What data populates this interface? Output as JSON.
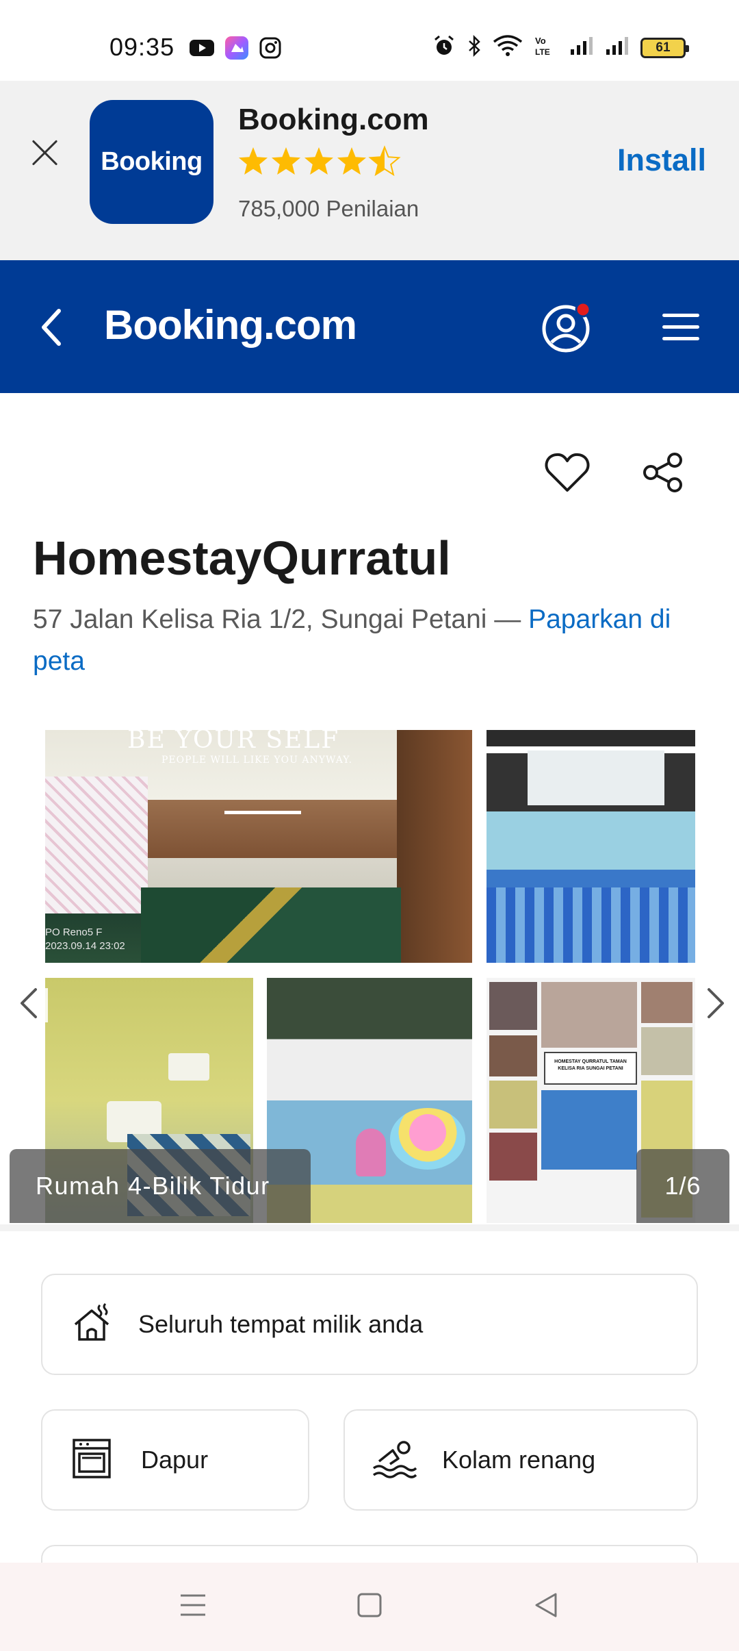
{
  "status_bar": {
    "time": "09:35",
    "battery": "61",
    "icons": [
      "youtube-icon",
      "gallery-app-icon",
      "instagram-icon",
      "alarm-icon",
      "bluetooth-icon",
      "wifi-icon",
      "volte-icon",
      "signal-icon",
      "signal-icon",
      "battery-icon"
    ]
  },
  "app_banner": {
    "logo_text": "Booking",
    "app_name": "Booking.com",
    "rating_stars": 4.5,
    "reviews": "785,000 Penilaian",
    "install_label": "Install"
  },
  "header": {
    "brand": "Booking.com",
    "icons": [
      "back-arrow-icon",
      "user-account-icon",
      "hamburger-menu-icon"
    ],
    "accent": "#003b95"
  },
  "property": {
    "name": "HomestayQurratul",
    "address": "57 Jalan Kelisa Ria 1/2, Sungai Petani — ",
    "map_link": "Paparkan di peta"
  },
  "gallery": {
    "label": "Rumah 4-Bilik Tidur",
    "counter": "1/6",
    "photo_texts": {
      "caption_big": "BE YOUR SELF",
      "caption_small": "PEOPLE WILL LIKE YOU ANYWAY.",
      "camera_stamp_1": "PO Reno5 F",
      "camera_stamp_2": "2023.09.14 23:02",
      "sign": "HOMESTAY QURRATUL TAMAN KELISA RIA SUNGAI PETANI"
    }
  },
  "facilities": [
    {
      "label": "Seluruh tempat milik anda",
      "icon": "house-heat-icon"
    },
    {
      "label": "Dapur",
      "icon": "oven-icon"
    },
    {
      "label": "Kolam renang",
      "icon": "swimming-icon"
    }
  ],
  "colors": {
    "brand_blue": "#003b95",
    "link_blue": "#0a6bc4",
    "star_yellow": "#febb02"
  }
}
